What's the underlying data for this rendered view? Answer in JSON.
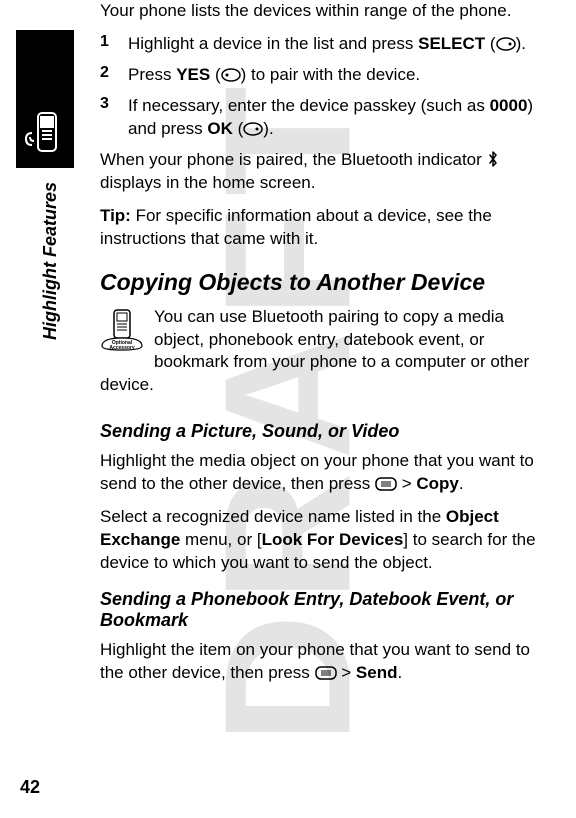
{
  "watermark": "DRAFT",
  "sideLabel": "Highlight Features",
  "pageNumber": "42",
  "intro": "Your phone lists the devices within range of the phone.",
  "steps": [
    {
      "num": "1",
      "textBefore": "Highlight a device in the list and press ",
      "bold1": "SELECT",
      "after1": " (",
      "after2": ")."
    },
    {
      "num": "2",
      "textBefore": "Press ",
      "bold1": "YES",
      "after1": " (",
      "after2": ") to pair with the device."
    },
    {
      "num": "3",
      "textBefore": "If necessary, enter the device passkey (such as ",
      "bold1": "0000",
      "mid": ") and press ",
      "bold2": "OK",
      "after1": " (",
      "after2": ")."
    }
  ],
  "paired": {
    "before": "When your phone is paired, the Bluetooth indicator ",
    "after": " displays in the home screen."
  },
  "tipLabel": "Tip:",
  "tipText": " For specific information about a device, see the instructions that came with it.",
  "h2_copy": "Copying Objects to Another Device",
  "copyPara": "You can use Bluetooth pairing to copy a media object, phonebook entry, datebook event, or bookmark from your phone to a computer or other device.",
  "h3_send1": "Sending a Picture, Sound, or Video",
  "send1a_before": "Highlight the media object on your phone that you want to send to the other device, then press ",
  "send1a_gt": " > ",
  "send1a_copy": "Copy",
  "send1a_end": ".",
  "send1b_before": "Select a recognized device name listed in the ",
  "send1b_bold1": "Object Exchange",
  "send1b_mid": " menu, or [",
  "send1b_bold2": "Look For Devices",
  "send1b_after": "] to search for the device to which you want to send the object.",
  "h3_send2": "Sending a Phonebook Entry, Datebook Event, or Bookmark",
  "send2_before": "Highlight the item on your phone that you want to send to the other device, then press ",
  "send2_gt": " > ",
  "send2_send": "Send",
  "send2_end": "."
}
